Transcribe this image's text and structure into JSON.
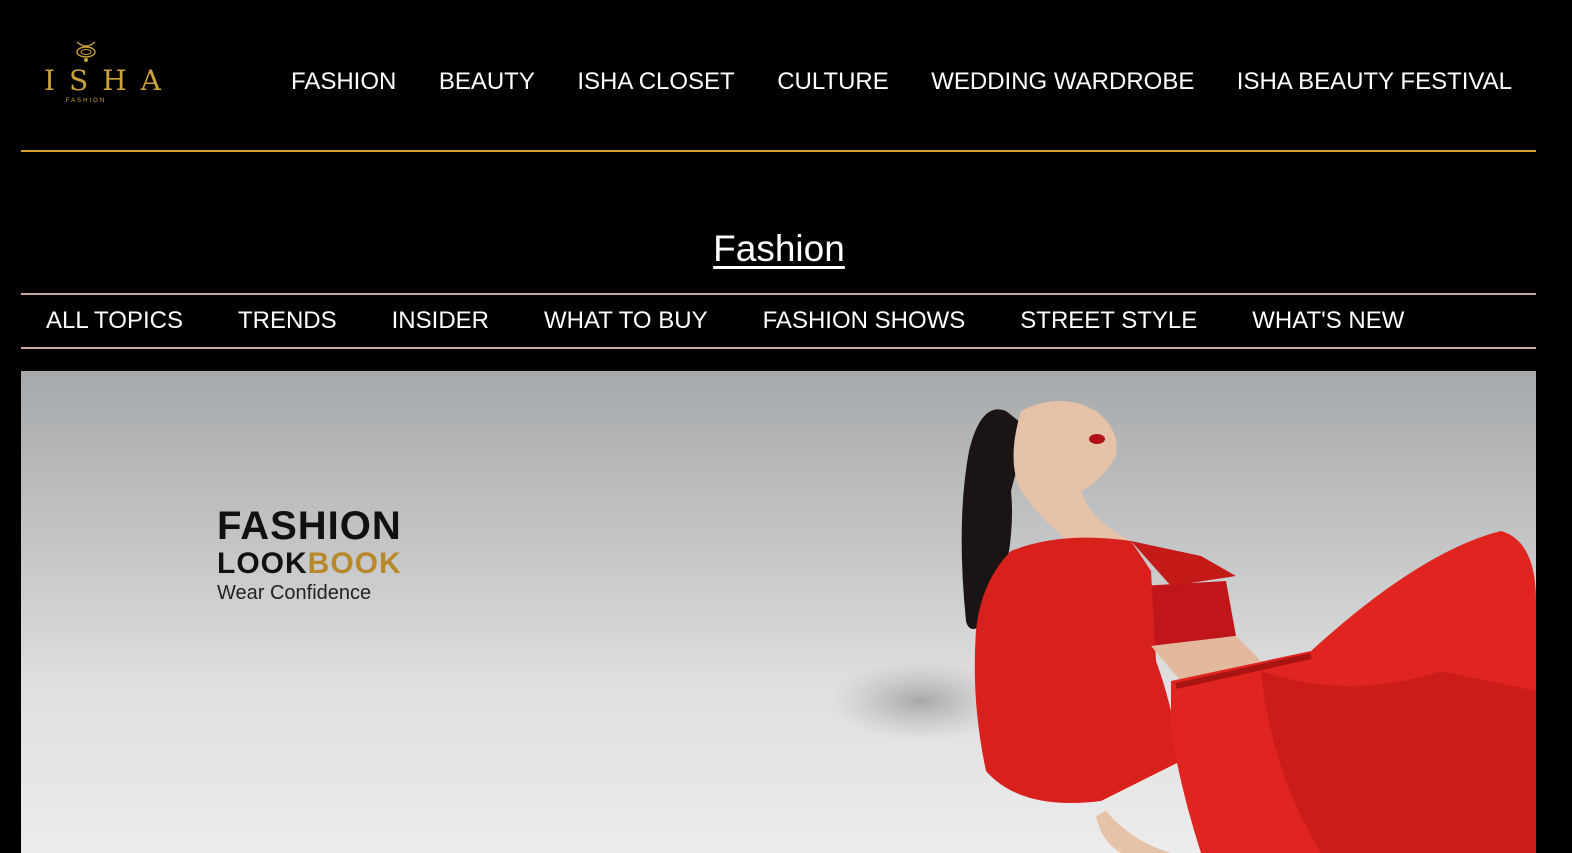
{
  "header": {
    "logo": {
      "brand": "ISHA",
      "sub": "FASHION"
    },
    "nav": [
      {
        "label": "FASHION"
      },
      {
        "label": "BEAUTY"
      },
      {
        "label": "ISHA CLOSET"
      },
      {
        "label": "CULTURE"
      },
      {
        "label": "WEDDING WARDROBE"
      },
      {
        "label": "ISHA BEAUTY FESTIVAL"
      }
    ]
  },
  "section": {
    "title": "Fashion"
  },
  "subnav": [
    {
      "label": "ALL TOPICS"
    },
    {
      "label": "TRENDS"
    },
    {
      "label": "INSIDER"
    },
    {
      "label": "WHAT TO BUY"
    },
    {
      "label": "FASHION SHOWS"
    },
    {
      "label": "STREET STYLE"
    },
    {
      "label": "WHAT'S NEW"
    }
  ],
  "hero": {
    "line1": "FASHION",
    "line2_a": "LOOK",
    "line2_b": "BOOK",
    "tagline": "Wear Confidence",
    "image": "woman-in-red-outfit-photo"
  },
  "colors": {
    "background": "#000000",
    "gold": "#d39f33",
    "accent_text": "#b8892a",
    "divider": "#c8a8a0",
    "outfit_red": "#d8201c"
  }
}
